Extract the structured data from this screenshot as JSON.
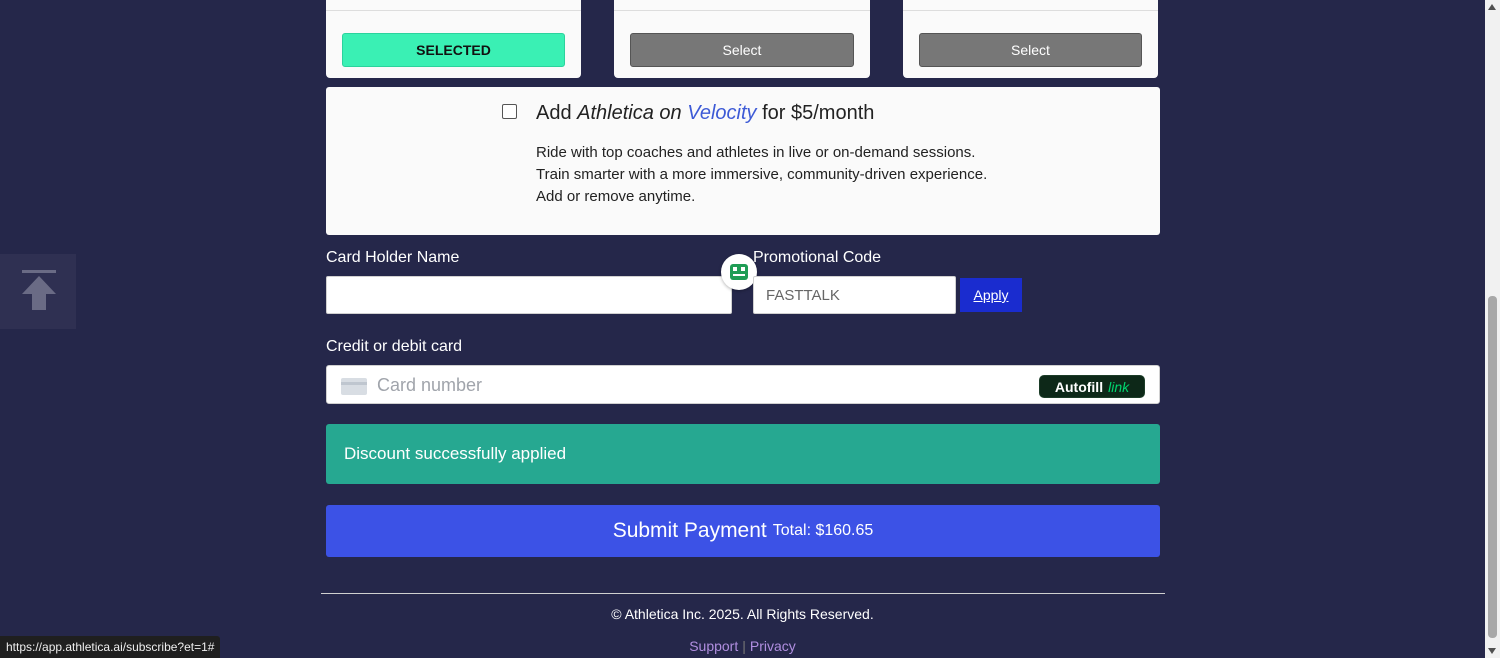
{
  "plans": [
    {
      "button_label": "SELECTED",
      "state": "selected"
    },
    {
      "button_label": "Select",
      "state": "default"
    },
    {
      "button_label": "Select",
      "state": "default"
    }
  ],
  "addon": {
    "prefix": "Add ",
    "brand": "Athletica",
    "on": " on ",
    "product": "Velocity",
    "suffix": " for $5/month",
    "checked": false,
    "description": [
      "Ride with top coaches and athletes in live or on-demand sessions.",
      "Train smarter with a more immersive, community-driven experience.",
      "Add or remove anytime."
    ]
  },
  "form": {
    "card_holder_label": "Card Holder Name",
    "card_holder_value": "",
    "promo_label": "Promotional Code",
    "promo_value": "FASTTALK",
    "apply_label": "Apply",
    "card_label": "Credit or debit card",
    "card_placeholder": "Card number",
    "autofill_label": "Autofill",
    "autofill_link": "link"
  },
  "discount_message": "Discount successfully applied",
  "submit": {
    "label": "Submit Payment",
    "total": "Total: $160.65"
  },
  "footer": {
    "copyright": "© Athletica Inc. 2025. All Rights Reserved.",
    "support": "Support",
    "separator": "|",
    "privacy": "Privacy"
  },
  "status_bar_url": "https://app.athletica.ai/subscribe?et=1#",
  "colors": {
    "background": "#25274a",
    "selected": "#3af0b4",
    "accent_blue": "#3c52e6",
    "success": "#26a891"
  }
}
